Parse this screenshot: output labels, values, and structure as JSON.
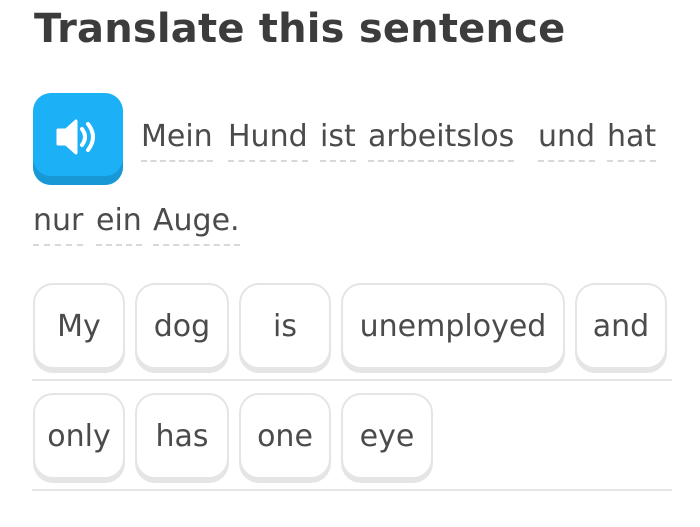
{
  "challenge": {
    "title": "Translate this sentence",
    "speaker_icon": "speaker-icon",
    "prompt_words": [
      "Mein",
      "Hund",
      "ist",
      "arbeitslos",
      "und",
      "hat",
      "nur",
      "ein",
      "Auge."
    ]
  },
  "answer": {
    "tiles": [
      "My",
      "dog",
      "is",
      "unemployed",
      "and",
      "only",
      "has",
      "one",
      "eye"
    ]
  },
  "colors": {
    "accent_blue": "#1cb0f6",
    "accent_blue_dark": "#1899d6",
    "tile_border": "#e5e5e5",
    "text": "#4b4b4b"
  }
}
